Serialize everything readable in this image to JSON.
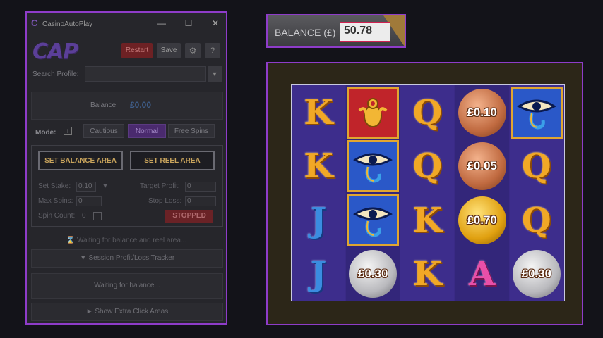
{
  "app": {
    "title": "CasinoAutoPlay",
    "logo_text": "CAP",
    "window_controls": {
      "minimize": "—",
      "maximize": "☐",
      "close": "✕"
    },
    "buttons": {
      "restart": "Restart",
      "save": "Save",
      "settings_icon": "⚙",
      "help": "?"
    },
    "search_label": "Search Profile:",
    "search_value": "",
    "dropdown_icon": "▼",
    "balance_label": "Balance:",
    "balance_value": "£0.00",
    "mode_label": "Mode:",
    "mode_info": "i",
    "modes": [
      "Cautious",
      "Normal",
      "Free Spins"
    ],
    "active_mode": "Normal",
    "set_balance_area": "SET BALANCE AREA",
    "set_reel_area": "SET REEL AREA",
    "set_stake_label": "Set Stake:",
    "set_stake_value": "0.10",
    "target_profit_label": "Target Profit:",
    "target_profit_value": "0",
    "max_spins_label": "Max Spins:",
    "max_spins_value": "0",
    "stop_loss_label": "Stop Loss:",
    "stop_loss_value": "0",
    "spin_count_label": "Spin Count:",
    "spin_count_value": "0",
    "status": "STOPPED",
    "waiting_message": "⌛ Waiting for balance and reel area...",
    "session_tracker": "▼ Session Profit/Loss Tracker",
    "waiting_balance": "Waiting for balance...",
    "extra_click_areas": "► Show Extra Click Areas"
  },
  "game": {
    "balance_label": "BALANCE (£)",
    "balance_value": "50.78",
    "reels": [
      [
        "K",
        "K",
        "J",
        "J"
      ],
      [
        "scarab",
        "eye",
        "eye",
        "£0.30"
      ],
      [
        "Q",
        "Q",
        "K",
        "K"
      ],
      [
        "£0.10",
        "£0.05",
        "£0.70",
        "A"
      ],
      [
        "eye",
        "Q",
        "Q",
        "£0.30"
      ]
    ]
  },
  "colors": {
    "accent": "#8e3cc9",
    "restart": "#6d2124",
    "stopped": "#6a2226",
    "mode_active": "#4a2a6e"
  }
}
